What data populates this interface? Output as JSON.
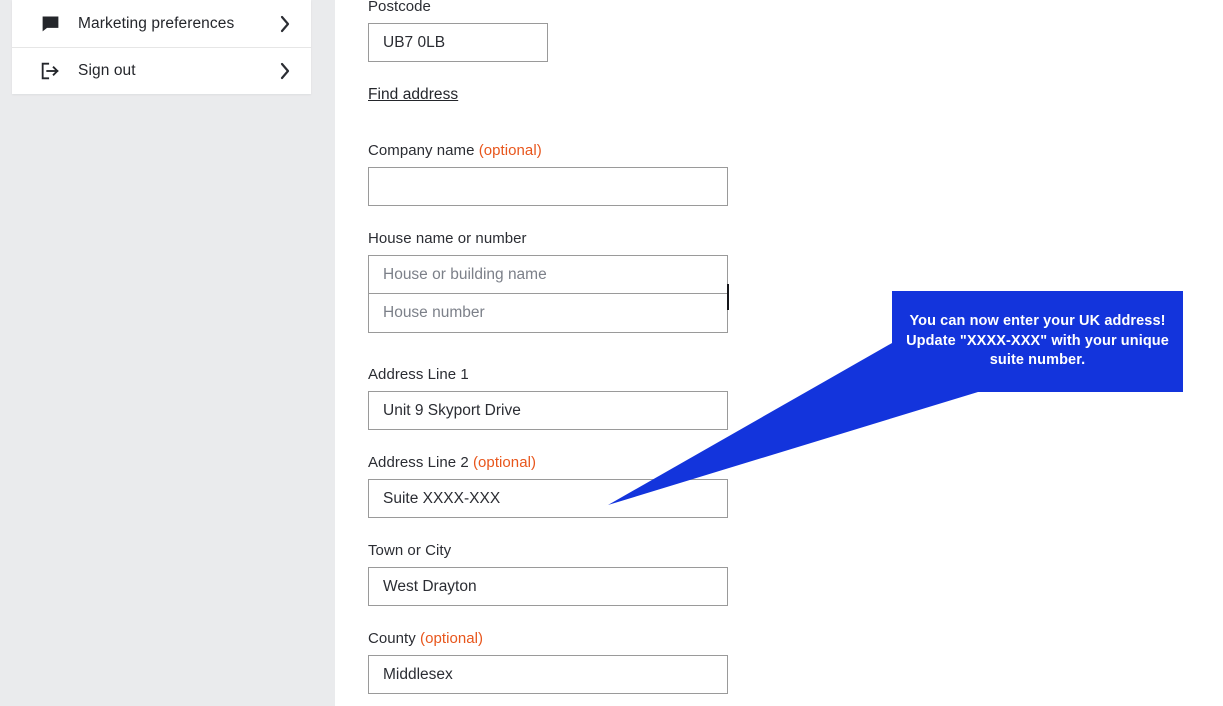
{
  "sidebar": {
    "items": [
      {
        "icon": "message-square-icon",
        "label": "Marketing preferences",
        "chevron": "chevron-right-icon"
      },
      {
        "icon": "sign-out-icon",
        "label": "Sign out",
        "chevron": "chevron-right-icon"
      }
    ]
  },
  "form": {
    "postcode": {
      "label": "Postcode",
      "value": "UB7 0LB",
      "placeholder": ""
    },
    "find_address_link": "Find address",
    "company_name": {
      "label": "Company name",
      "optional": "(optional)",
      "value": "",
      "placeholder": ""
    },
    "house": {
      "label": "House name or number",
      "name_value": "",
      "name_placeholder": "House or building name",
      "number_value": "",
      "number_placeholder": "House number"
    },
    "address_line_1": {
      "label": "Address Line 1",
      "value": "Unit 9 Skyport Drive",
      "placeholder": ""
    },
    "address_line_2": {
      "label": "Address Line 2",
      "optional": "(optional)",
      "value": "Suite XXXX-XXX",
      "placeholder": ""
    },
    "town_or_city": {
      "label": "Town or City",
      "value": "West Drayton",
      "placeholder": ""
    },
    "county": {
      "label": "County",
      "optional": "(optional)",
      "value": "Middlesex",
      "placeholder": ""
    }
  },
  "tooltip": {
    "text": "You can now enter your UK address! Update \"XXXX-XXX\" with your unique suite number.",
    "background_color": "#1334DC",
    "text_color": "#FFFFFF"
  },
  "colors": {
    "page_background": "#FFFFFF",
    "sidebar_background": "#EAEBED",
    "card_background": "#FFFFFF",
    "text_primary": "#2B2D33",
    "optional_orange": "#E8561C",
    "input_border": "#9A9A9A",
    "placeholder": "#7C8089",
    "callout_blue": "#1334DC"
  }
}
